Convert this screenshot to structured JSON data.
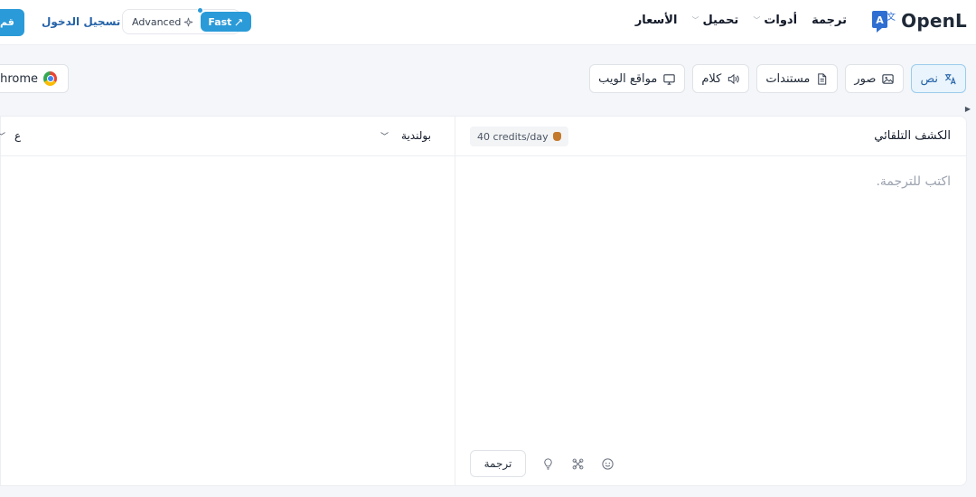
{
  "header": {
    "logo_text": "OpenL",
    "nav": [
      {
        "label": "ترجمة",
        "has_menu": false
      },
      {
        "label": "أدوات",
        "has_menu": true
      },
      {
        "label": "تحميل",
        "has_menu": true
      },
      {
        "label": "الأسعار",
        "has_menu": false
      }
    ],
    "mode": {
      "advanced_label": "Advanced",
      "fast_label": "Fast",
      "selected": "Fast"
    },
    "login_label": "تسجيل الدخول",
    "cta_label": "قم"
  },
  "toolbar": {
    "tabs": [
      {
        "label": "نص",
        "icon": "translate-icon",
        "active": true
      },
      {
        "label": "صور",
        "icon": "image-icon",
        "active": false
      },
      {
        "label": "مستندات",
        "icon": "document-icon",
        "active": false
      },
      {
        "label": "كلام",
        "icon": "speaker-icon",
        "active": false
      },
      {
        "label": "مواقع الويب",
        "icon": "monitor-icon",
        "active": false
      }
    ],
    "chrome_label": "Chrome"
  },
  "source": {
    "language": "الكشف التلقائي",
    "credits": "40 credits/day",
    "placeholder": "اكتب للترجمة."
  },
  "target": {
    "language": "بولندية",
    "second_language": "ع"
  },
  "actions": {
    "translate_label": "ترجمة",
    "icons": [
      "smile-icon",
      "sparkle-icon",
      "bulb-icon"
    ]
  },
  "colors": {
    "accent": "#2a9ad8",
    "link": "#2563a8"
  }
}
